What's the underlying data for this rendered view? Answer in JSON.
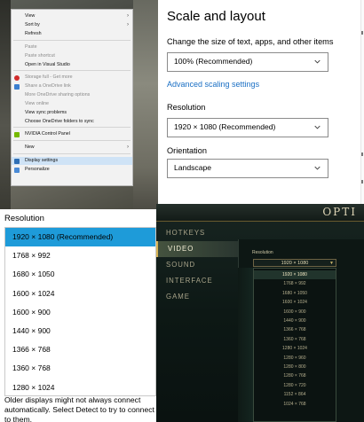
{
  "context_menu": {
    "items": [
      {
        "label": "View",
        "submenu": true,
        "disabled": false,
        "icon": null
      },
      {
        "label": "Sort by",
        "submenu": true,
        "disabled": false,
        "icon": null
      },
      {
        "label": "Refresh",
        "submenu": false,
        "disabled": false,
        "icon": null
      },
      {
        "label": "Paste",
        "submenu": false,
        "disabled": true,
        "icon": null
      },
      {
        "label": "Paste shortcut",
        "submenu": false,
        "disabled": true,
        "icon": null
      },
      {
        "label": "Open in Visual Studio",
        "submenu": false,
        "disabled": false,
        "icon": null
      },
      {
        "label": "Storage full - Get more",
        "submenu": false,
        "disabled": true,
        "icon": "storage-warning-icon"
      },
      {
        "label": "Share a OneDrive link",
        "submenu": false,
        "disabled": true,
        "icon": "onedrive-icon"
      },
      {
        "label": "More OneDrive sharing options",
        "submenu": false,
        "disabled": true,
        "icon": null
      },
      {
        "label": "View online",
        "submenu": false,
        "disabled": true,
        "icon": null
      },
      {
        "label": "View sync problems",
        "submenu": false,
        "disabled": false,
        "icon": null
      },
      {
        "label": "Choose OneDrive folders to sync",
        "submenu": false,
        "disabled": false,
        "icon": null
      },
      {
        "label": "NVIDIA Control Panel",
        "submenu": false,
        "disabled": false,
        "icon": "nvidia-icon"
      },
      {
        "label": "New",
        "submenu": true,
        "disabled": false,
        "icon": null
      },
      {
        "label": "Display settings",
        "submenu": false,
        "disabled": false,
        "icon": "display-icon"
      },
      {
        "label": "Personalize",
        "submenu": false,
        "disabled": false,
        "icon": "personalize-icon"
      }
    ]
  },
  "settings": {
    "title": "Scale and layout",
    "scale_label": "Change the size of text, apps, and other items",
    "scale_value": "100% (Recommended)",
    "advanced_link": "Advanced scaling settings",
    "resolution_label": "Resolution",
    "resolution_value": "1920 × 1080 (Recommended)",
    "orientation_label": "Orientation",
    "orientation_value": "Landscape"
  },
  "resolution_list": {
    "title": "Resolution",
    "options": [
      "1920 × 1080 (Recommended)",
      "1768 × 992",
      "1680 × 1050",
      "1600 × 1024",
      "1600 × 900",
      "1440 × 900",
      "1366 × 768",
      "1360 × 768",
      "1280 × 1024"
    ],
    "selected_index": 0,
    "note": "Older displays might not always connect automatically. Select Detect to try to connect to them."
  },
  "game_options": {
    "title": "OPTI",
    "nav": [
      "HOTKEYS",
      "VIDEO",
      "SOUND",
      "INTERFACE",
      "GAME"
    ],
    "active_nav": "VIDEO",
    "resolution_label": "Resolution",
    "resolution_value": "1920 × 1080",
    "options": [
      "1920 × 1080",
      "1768 × 992",
      "1680 × 1050",
      "1600 × 1024",
      "1600 × 900",
      "1440 × 900",
      "1366 × 768",
      "1360 × 768",
      "1280 × 1024",
      "1280 × 960",
      "1280 × 800",
      "1280 × 768",
      "1280 × 720",
      "1152 × 864",
      "1024 × 768"
    ],
    "current_index": 0
  }
}
